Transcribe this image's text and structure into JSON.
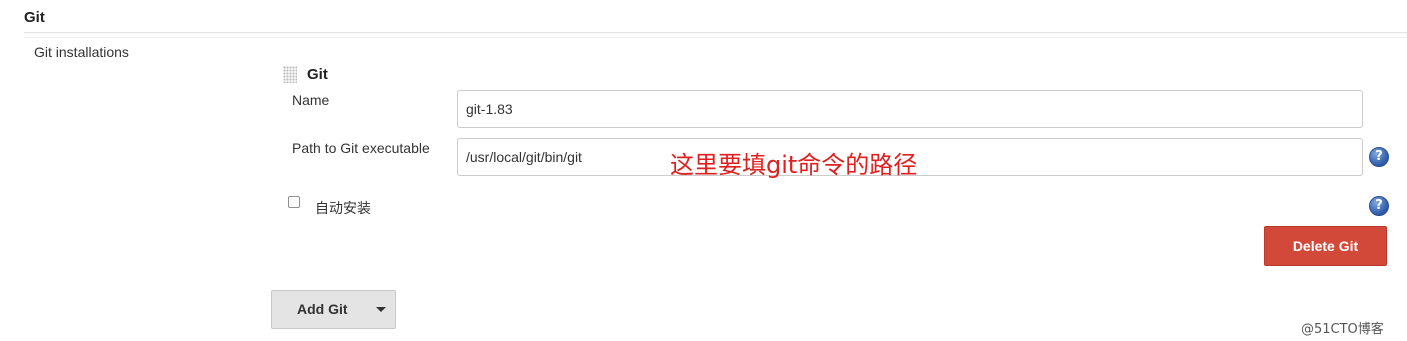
{
  "section": {
    "title": "Git"
  },
  "installations": {
    "label": "Git installations",
    "item": {
      "title": "Git",
      "name_label": "Name",
      "name_value": "git-1.83",
      "path_label": "Path to Git executable",
      "path_value": "/usr/local/git/bin/git",
      "annotation": "这里要填git命令的路径",
      "auto_install_label": "自动安装",
      "auto_install_checked": false,
      "delete_label": "Delete Git"
    },
    "add_label": "Add Git"
  },
  "help_icon_glyph": "?",
  "watermark": "@51CTO博客",
  "colors": {
    "delete_button": "#d24939",
    "annotation": "#e02020",
    "help_icon": "#2d5aa8"
  }
}
